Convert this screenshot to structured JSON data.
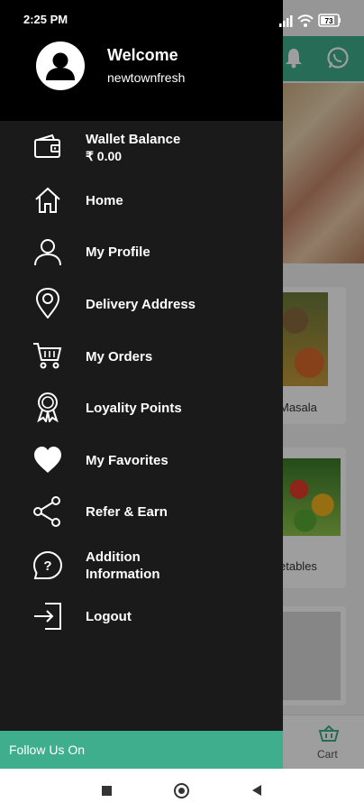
{
  "status_bar": {
    "time": "2:25 PM",
    "battery": "73"
  },
  "drawer": {
    "welcome": "Welcome",
    "username": "newtownfresh",
    "wallet": {
      "title": "Wallet Balance",
      "value": "₹ 0.00"
    },
    "items": [
      {
        "label": "Home",
        "icon": "home-icon"
      },
      {
        "label": "My Profile",
        "icon": "profile-icon"
      },
      {
        "label": "Delivery Address",
        "icon": "location-pin-icon"
      },
      {
        "label": "My Orders",
        "icon": "cart-icon"
      },
      {
        "label": "Loyality Points",
        "icon": "badge-icon"
      },
      {
        "label": "My Favorites",
        "icon": "heart-icon"
      },
      {
        "label": "Refer & Earn",
        "icon": "share-icon"
      },
      {
        "label": "Addition\nInformation",
        "icon": "help-icon"
      },
      {
        "label": "Logout",
        "icon": "logout-icon"
      }
    ],
    "follow_us": "Follow Us On"
  },
  "background": {
    "card_labels": [
      "Masala",
      "etables"
    ],
    "cart_label": "Cart"
  },
  "colors": {
    "accent": "#3fae8d",
    "drawer_bg": "#1a1a1a",
    "header_bg": "#000000"
  }
}
